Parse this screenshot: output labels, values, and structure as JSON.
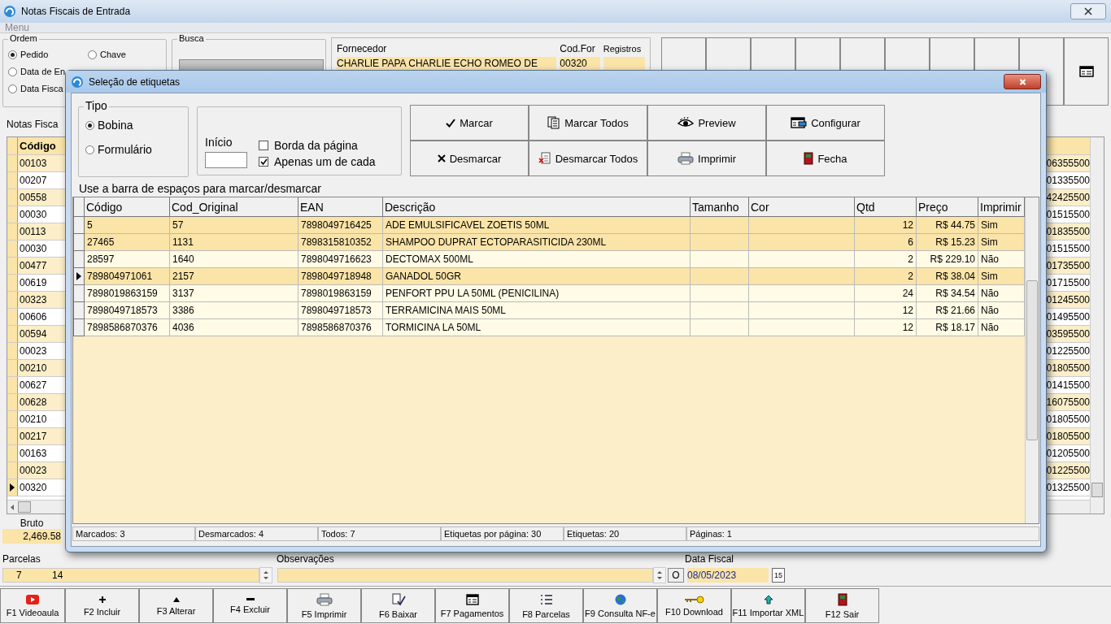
{
  "window": {
    "title": "Notas Fiscais de Entrada"
  },
  "menu": [
    "Menu"
  ],
  "ordem": {
    "title": "Ordem",
    "options": [
      {
        "label": "Pedido",
        "selected": true
      },
      {
        "label": "Chave",
        "selected": false
      },
      {
        "label": "Data de En",
        "selected": false
      },
      {
        "label": "Data Fisca",
        "selected": false
      }
    ]
  },
  "busca": {
    "title": "Busca"
  },
  "fornecedor": {
    "label": "Fornecedor",
    "value": "CHARLIE PAPA CHARLIE ECHO ROMEO DE",
    "cod_label": "Cod.For",
    "cod_value": "00320",
    "registros_label": "Registros"
  },
  "notas_tab": "Notas Fisca",
  "notas_grid": {
    "columns": [
      "Código"
    ],
    "rows": [
      {
        "codigo": "00103",
        "column_2": "06355500",
        "selected": false
      },
      {
        "codigo": "00207",
        "column_2": "01335500",
        "selected": false
      },
      {
        "codigo": "00558",
        "column_2": "42425500",
        "selected": false
      },
      {
        "codigo": "00030",
        "column_2": "01515500",
        "selected": false
      },
      {
        "codigo": "00113",
        "column_2": "01835500",
        "selected": false
      },
      {
        "codigo": "00030",
        "column_2": "01515500",
        "selected": false
      },
      {
        "codigo": "00477",
        "column_2": "01735500",
        "selected": false
      },
      {
        "codigo": "00619",
        "column_2": "01715500",
        "selected": false
      },
      {
        "codigo": "00323",
        "column_2": "01245500",
        "selected": false
      },
      {
        "codigo": "00606",
        "column_2": "01495500",
        "selected": false
      },
      {
        "codigo": "00594",
        "column_2": "03595500",
        "selected": false
      },
      {
        "codigo": "00023",
        "column_2": "01225500",
        "selected": false
      },
      {
        "codigo": "00210",
        "column_2": "01805500",
        "selected": false
      },
      {
        "codigo": "00627",
        "column_2": "01415500",
        "selected": false
      },
      {
        "codigo": "00628",
        "column_2": "16075500",
        "selected": false
      },
      {
        "codigo": "00210",
        "column_2": "01805500",
        "selected": false
      },
      {
        "codigo": "00217",
        "column_2": "01805500",
        "selected": false
      },
      {
        "codigo": "00163",
        "column_2": "01205500",
        "selected": false
      },
      {
        "codigo": "00023",
        "column_2": "01225500",
        "selected": false
      },
      {
        "codigo": "00320",
        "column_2": "01325500",
        "selected": true
      }
    ]
  },
  "totals": {
    "bruto_label": "Bruto",
    "bruto_value": "2,469.58"
  },
  "parcelas": {
    "label": "Parcelas",
    "value_1": "7",
    "value_2": "14"
  },
  "observacoes": {
    "label": "Observações",
    "button": "O"
  },
  "data_fiscal": {
    "label": "Data Fiscal",
    "value": "08/05/2023",
    "button": "15"
  },
  "function_keys": [
    {
      "label": "F1 Videoaula",
      "kind": "video"
    },
    {
      "label": "F2 Incluir",
      "kind": "plus"
    },
    {
      "label": "F3 Alterar",
      "kind": "up"
    },
    {
      "label": "F4 Excluir",
      "kind": "minus"
    },
    {
      "label": "F5 Imprimir",
      "kind": "printer"
    },
    {
      "label": "F6 Baixar",
      "kind": "pen"
    },
    {
      "label": "F7 Pagamentos",
      "kind": "form"
    },
    {
      "label": "F8 Parcelas",
      "kind": "list"
    },
    {
      "label": "F9 Consulta NF-e",
      "kind": "globe"
    },
    {
      "label": "F10 Download",
      "kind": "key"
    },
    {
      "label": "F11 Importar XML",
      "kind": "arrow"
    },
    {
      "label": "F12 Sair",
      "kind": "door"
    }
  ],
  "dialog": {
    "title": "Seleção de etiquetas",
    "tipo": {
      "title": "Tipo",
      "options": [
        {
          "label": "Bobina",
          "selected": true
        },
        {
          "label": "Formulário",
          "selected": false
        }
      ]
    },
    "inicio": {
      "label": "Início"
    },
    "checks": [
      {
        "label": "Borda da página",
        "checked": false
      },
      {
        "label": "Apenas um de cada",
        "checked": true
      }
    ],
    "buttons": [
      {
        "label": "Marcar",
        "kind": "check"
      },
      {
        "label": "Marcar Todos",
        "kind": "pages"
      },
      {
        "label": "Preview",
        "kind": "eye"
      },
      {
        "label": "Configurar",
        "kind": "config"
      },
      {
        "label": "Desmarcar",
        "kind": "cross"
      },
      {
        "label": "Desmarcar Todos",
        "kind": "unpages"
      },
      {
        "label": "Imprimir",
        "kind": "printer"
      },
      {
        "label": "Fecha",
        "kind": "door"
      }
    ],
    "hint": "Use a barra de espaços para marcar/desmarcar",
    "table": {
      "columns": [
        "Código",
        "Cod_Original",
        "EAN",
        "Descrição",
        "Tamanho",
        "Cor",
        "Qtd",
        "Preço",
        "Imprimir"
      ],
      "rows": [
        {
          "cells": [
            "5",
            "57",
            "7898049716425",
            "ADE EMULSIFICAVEL ZOETIS 50ML",
            "",
            "",
            "12",
            "R$ 44.75",
            "Sim"
          ],
          "marked": true,
          "selected": false
        },
        {
          "cells": [
            "27465",
            "1131",
            "7898315810352",
            "SHAMPOO DUPRAT ECTOPARASITICIDA 230ML",
            "",
            "",
            "6",
            "R$ 15.23",
            "Sim"
          ],
          "marked": true,
          "selected": false
        },
        {
          "cells": [
            "28597",
            "1640",
            "7898049716623",
            "DECTOMAX 500ML",
            "",
            "",
            "2",
            "R$ 229.10",
            "Não"
          ],
          "marked": false,
          "selected": false
        },
        {
          "cells": [
            "789804971061",
            "2157",
            "7898049718948",
            "GANADOL 50GR",
            "",
            "",
            "2",
            "R$ 38.04",
            "Sim"
          ],
          "marked": true,
          "selected": true
        },
        {
          "cells": [
            "7898019863159",
            "3137",
            "7898019863159",
            "PENFORT PPU LA 50ML (PENICILINA)",
            "",
            "",
            "24",
            "R$ 34.54",
            "Não"
          ],
          "marked": false,
          "selected": false
        },
        {
          "cells": [
            "7898049718573",
            "3386",
            "7898049718573",
            "TERRAMICINA MAIS 50ML",
            "",
            "",
            "12",
            "R$ 21.66",
            "Não"
          ],
          "marked": false,
          "selected": false
        },
        {
          "cells": [
            "7898586870376",
            "4036",
            "7898586870376",
            "TORMICINA LA 50ML",
            "",
            "",
            "12",
            "R$ 18.17",
            "Não"
          ],
          "marked": false,
          "selected": false
        }
      ]
    },
    "status": [
      "Marcados: 3",
      "Desmarcados: 4",
      "Todos: 7",
      "Etiquetas por página: 30",
      "Etiquetas: 20",
      "Páginas: 1"
    ]
  }
}
